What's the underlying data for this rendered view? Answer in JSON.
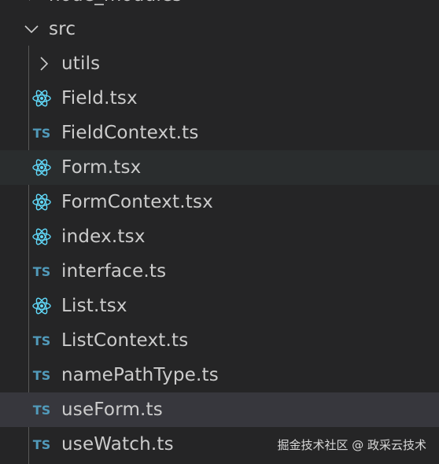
{
  "explorer": {
    "cut_off_item": "node_modules",
    "folder": {
      "label": "src",
      "icon": "chevron-down-icon",
      "expanded": true
    },
    "items": [
      {
        "label": "utils",
        "kind": "folder",
        "icon": "chevron-right-icon"
      },
      {
        "label": "Field.tsx",
        "kind": "tsx",
        "icon": "react-icon"
      },
      {
        "label": "FieldContext.ts",
        "kind": "ts",
        "icon": "typescript-icon",
        "badge": "TS"
      },
      {
        "label": "Form.tsx",
        "kind": "tsx",
        "icon": "react-icon",
        "state": "hover"
      },
      {
        "label": "FormContext.tsx",
        "kind": "tsx",
        "icon": "react-icon"
      },
      {
        "label": "index.tsx",
        "kind": "tsx",
        "icon": "react-icon"
      },
      {
        "label": "interface.ts",
        "kind": "ts",
        "icon": "typescript-icon",
        "badge": "TS"
      },
      {
        "label": "List.tsx",
        "kind": "tsx",
        "icon": "react-icon"
      },
      {
        "label": "ListContext.ts",
        "kind": "ts",
        "icon": "typescript-icon",
        "badge": "TS"
      },
      {
        "label": "namePathType.ts",
        "kind": "ts",
        "icon": "typescript-icon",
        "badge": "TS"
      },
      {
        "label": "useForm.ts",
        "kind": "ts",
        "icon": "typescript-icon",
        "badge": "TS",
        "state": "selected"
      },
      {
        "label": "useWatch.ts",
        "kind": "ts",
        "icon": "typescript-icon",
        "badge": "TS"
      }
    ]
  },
  "watermark": "掘金技术社区 @ 政采云技术",
  "colors": {
    "background": "#252526",
    "text": "#cccccc",
    "react": "#61dafb",
    "typescript": "#519aba",
    "hover": "#2a2d2e",
    "selected": "#37373d"
  }
}
